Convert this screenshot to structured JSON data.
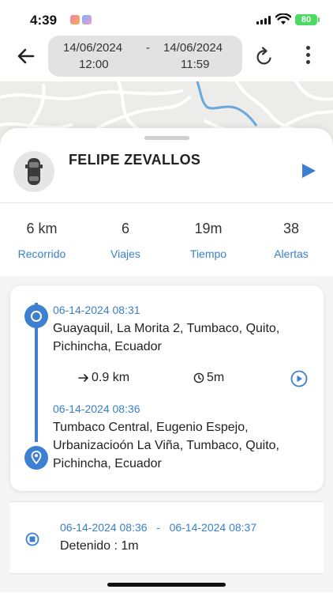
{
  "status_bar": {
    "time": "4:39",
    "battery": "80"
  },
  "header": {
    "start_date": "14/06/2024",
    "start_time": "12:00",
    "separator": "-",
    "end_date": "14/06/2024",
    "end_time": "11:59"
  },
  "driver": {
    "name": "FELIPE ZEVALLOS"
  },
  "stats": [
    {
      "value": "6 km",
      "label": "Recorrido"
    },
    {
      "value": "6",
      "label": "Viajes"
    },
    {
      "value": "19m",
      "label": "Tiempo"
    },
    {
      "value": "38",
      "label": "Alertas"
    }
  ],
  "trip": {
    "start_timestamp": "06-14-2024 08:31",
    "start_address": "Guayaquil, La Morita 2, Tumbaco, Quito, Pichincha, Ecuador",
    "distance": "0.9 km",
    "duration": "5m",
    "end_timestamp": "06-14-2024 08:36",
    "end_address": "Tumbaco Central, Eugenio Espejo, Urbanizacioón La Viña, Tumbaco, Quito, Pichincha, Ecuador"
  },
  "stop": {
    "start": "06-14-2024 08:36",
    "separator": "-",
    "end": "06-14-2024 08:37",
    "label": "Detenido : 1m"
  },
  "colors": {
    "accent": "#3d7fd0",
    "label_blue": "#3a80c9",
    "pill_bg": "#e2e2e2"
  }
}
